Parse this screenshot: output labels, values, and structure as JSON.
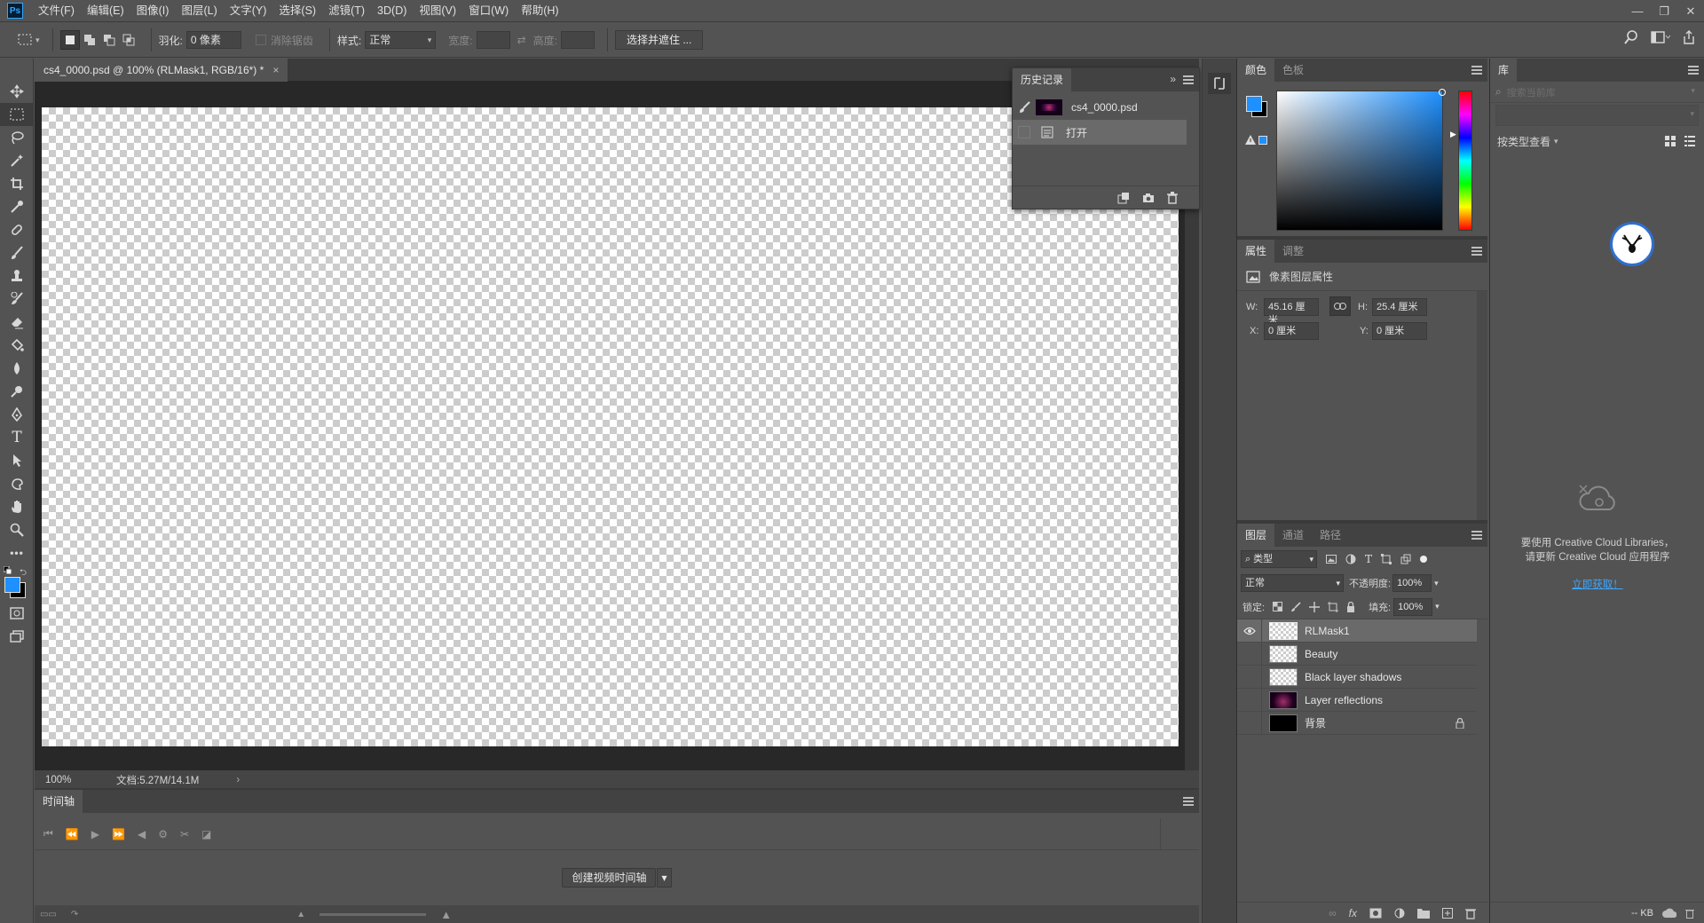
{
  "menubar": {
    "logo": "Ps",
    "items": [
      "文件(F)",
      "编辑(E)",
      "图像(I)",
      "图层(L)",
      "文字(Y)",
      "选择(S)",
      "滤镜(T)",
      "3D(D)",
      "视图(V)",
      "窗口(W)",
      "帮助(H)"
    ]
  },
  "options": {
    "feather_label": "羽化:",
    "feather_value": "0 像素",
    "antialias_label": "消除锯齿",
    "style_label": "样式:",
    "style_value": "正常",
    "width_label": "宽度:",
    "height_label": "高度:",
    "select_mask_button": "选择并遮住 ..."
  },
  "document": {
    "tab_title": "cs4_0000.psd @ 100% (RLMask1, RGB/16*) *",
    "zoom": "100%",
    "doc_info": "文档:5.27M/14.1M"
  },
  "history": {
    "title": "历史记录",
    "snapshot_name": "cs4_0000.psd",
    "steps": [
      "打开"
    ]
  },
  "timeline": {
    "title": "时间轴",
    "create_button": "创建视频时间轴"
  },
  "color_panel": {
    "tabs": [
      "颜色",
      "色板"
    ],
    "foreground": "#1e90ff",
    "background": "#000000"
  },
  "properties": {
    "tabs": [
      "属性",
      "调整"
    ],
    "heading": "像素图层属性",
    "w_label": "W:",
    "w_value": "45.16 厘米",
    "h_label": "H:",
    "h_value": "25.4 厘米",
    "x_label": "X:",
    "x_value": "0 厘米",
    "y_label": "Y:",
    "y_value": "0 厘米"
  },
  "layers_panel": {
    "tabs": [
      "图层",
      "通道",
      "路径"
    ],
    "filter_kind": "类型",
    "blend_mode": "正常",
    "opacity_label": "不透明度:",
    "opacity_value": "100%",
    "lock_label": "锁定:",
    "fill_label": "填充:",
    "fill_value": "100%",
    "layers": [
      {
        "name": "RLMask1",
        "visible": true,
        "selected": true
      },
      {
        "name": "Beauty",
        "visible": false,
        "selected": false
      },
      {
        "name": "Black layer shadows",
        "visible": false,
        "selected": false
      },
      {
        "name": "Layer reflections",
        "visible": false,
        "selected": false
      },
      {
        "name": "背景",
        "visible": false,
        "selected": false,
        "locked": true
      }
    ]
  },
  "library": {
    "title": "库",
    "search_placeholder": "搜索当前库",
    "view_by": "按类型查看",
    "message_line1": "要使用 Creative Cloud Libraries，",
    "message_line2": "请更新 Creative Cloud 应用程序",
    "link": "立即获取！",
    "size": "-- KB"
  }
}
